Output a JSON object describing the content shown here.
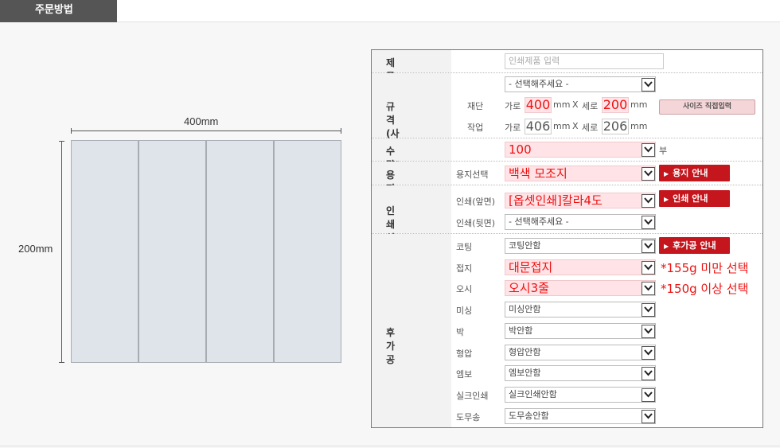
{
  "header": {
    "title": "주문방법"
  },
  "diagram": {
    "width_label": "400mm",
    "height_label": "200mm",
    "panels": 4
  },
  "form": {
    "title": {
      "label": "제목",
      "placeholder": "인쇄제품 입력"
    },
    "size": {
      "label": "규격(사이즈)",
      "select": "- 선택해주세요 -",
      "custom_button": "사이즈 직접입력",
      "cut": {
        "label": "재단",
        "w_label": "가로",
        "w": "400",
        "unit1": "mm",
        "x": "X",
        "h_label": "세로",
        "h": "200",
        "unit2": "mm"
      },
      "work": {
        "label": "작업",
        "w_label": "가로",
        "w": "406",
        "unit1": "mm",
        "x": "X",
        "h_label": "세로",
        "h": "206",
        "unit2": "mm"
      }
    },
    "quantity": {
      "label": "수량",
      "value": "100",
      "unit": "부"
    },
    "paper": {
      "label": "용지",
      "sublabel": "용지선택",
      "value": "백색 모조지",
      "button": "용지 안내"
    },
    "print": {
      "label": "인쇄선택",
      "front_label": "인쇄(앞면)",
      "front_value": "[옵셋인쇄]칼라4도",
      "button": "인쇄 안내",
      "back_label": "인쇄(뒷면)",
      "back_value": "- 선택해주세요 -"
    },
    "postprocess": {
      "label": "후가공",
      "button": "후가공 안내",
      "rows": [
        {
          "label": "코팅",
          "value": "코팅안함"
        },
        {
          "label": "접지",
          "value": "대문접지",
          "note": "*155g 미만 선택"
        },
        {
          "label": "오시",
          "value": "오시3줄",
          "note": "*150g 이상 선택"
        },
        {
          "label": "미싱",
          "value": "미싱안함"
        },
        {
          "label": "박",
          "value": "박안함"
        },
        {
          "label": "형압",
          "value": "형압안함"
        },
        {
          "label": "엠보",
          "value": "엠보안함"
        },
        {
          "label": "실크인쇄",
          "value": "실크인쇄안함"
        },
        {
          "label": "도무송",
          "value": "도무송안함"
        }
      ]
    }
  }
}
